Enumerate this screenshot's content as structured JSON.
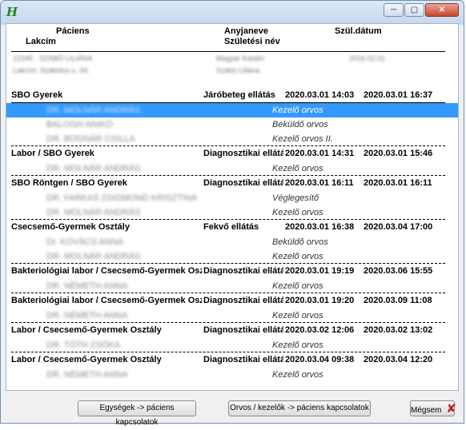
{
  "window": {
    "icon_glyph": "H",
    "minimize": "─",
    "maximize": "▢",
    "close": "✕"
  },
  "headers": {
    "col1": "Páciens",
    "col1_sub": "Lakcím",
    "col2": "Anyjaneve",
    "col2_sub": "Születési név",
    "col3": "Szül.dátum"
  },
  "patient": {
    "line1": "12345 · SZABÓ LILIÁNA",
    "line1_col2": "Magyar Katalin",
    "line1_date": "2016.02.01",
    "line2": "Lakcím: Szabolcs u. 34.",
    "line2_col2": "Szabó Liliána"
  },
  "rows": [
    {
      "kind": "unit",
      "name": "SBO Gyerek",
      "type": "Járóbeteg ellátás",
      "start": "2020.03.01 14:03",
      "end": "2020.03.01 16:37"
    },
    {
      "kind": "sub",
      "person": "DR. MOLNÁR ANDRÁS",
      "role": "Kezelő orvos",
      "selected": true
    },
    {
      "kind": "sub",
      "person": "BALOGH ANIKÓ",
      "role": "Beküldő orvos"
    },
    {
      "kind": "sub",
      "person": "DR. BOGNÁR CSILLA",
      "role": "Kezelő orvos II."
    },
    {
      "kind": "unit",
      "name": "Labor / SBO Gyerek",
      "type": "Diagnosztikai ellátás",
      "start": "2020.03.01 14:31",
      "end": "2020.03.01 15:46"
    },
    {
      "kind": "sub",
      "person": "DR. MOLNÁR ANDRÁS",
      "role": "Kezelő orvos"
    },
    {
      "kind": "unit",
      "name": "SBO Röntgen / SBO Gyerek",
      "type": "Diagnosztikai ellátás",
      "start": "2020.03.01 16:11",
      "end": "2020.03.01 16:11"
    },
    {
      "kind": "sub",
      "person": "DR. FARKAS ZSIGMOND KRISZTINA",
      "role": "Véglegesítő"
    },
    {
      "kind": "sub",
      "person": "DR. MOLNÁR ANDRÁS",
      "role": "Kezelő orvos"
    },
    {
      "kind": "unit",
      "name": "Csecsemő-Gyermek Osztály",
      "type": "Fekvő ellátás",
      "start": "2020.03.01 16:38",
      "end": "2020.03.04 17:00"
    },
    {
      "kind": "sub",
      "person": "Dr. KOVÁCS ANNA",
      "role": "Beküldő orvos"
    },
    {
      "kind": "sub",
      "person": "DR. MOLNÁR ANDRÁS",
      "role": "Kezelő orvos"
    },
    {
      "kind": "unit",
      "name": "Bakteriológiai labor / Csecsemő-Gyermek Oszt",
      "type": "Diagnosztikai ellátás",
      "start": "2020.03.01 19:19",
      "end": "2020.03.06 15:55"
    },
    {
      "kind": "sub",
      "person": "DR. NÉMETH ANNA",
      "role": "Kezelő orvos"
    },
    {
      "kind": "unit",
      "name": "Bakteriológiai labor / Csecsemő-Gyermek Oszt",
      "type": "Diagnosztikai ellátás",
      "start": "2020.03.01 19:20",
      "end": "2020.03.09 11:08"
    },
    {
      "kind": "sub",
      "person": "DR. NÉMETH ANNA",
      "role": "Kezelő orvos"
    },
    {
      "kind": "unit",
      "name": "Labor / Csecsemő-Gyermek Osztály",
      "type": "Diagnosztikai ellátás",
      "start": "2020.03.02 12:06",
      "end": "2020.03.02 13:02"
    },
    {
      "kind": "sub",
      "person": "DR. TÓTH ZSÓKA",
      "role": "Kezelő orvos"
    },
    {
      "kind": "unit",
      "name": "Labor / Csecsemő-Gyermek Osztály",
      "type": "Diagnosztikai ellátás",
      "start": "2020.03.04 09:38",
      "end": "2020.03.04 12:20"
    },
    {
      "kind": "sub",
      "person": "DR. NÉMETH ANNA",
      "role": "Kezelő orvos"
    }
  ],
  "buttons": {
    "units_to_patient": "Egységek -> páciens kapcsolatok",
    "doctors_to_patient": "Orvos / kezelők -> páciens kapcsolatok",
    "cancel": "Mégsem",
    "cancel_icon": "✘"
  }
}
